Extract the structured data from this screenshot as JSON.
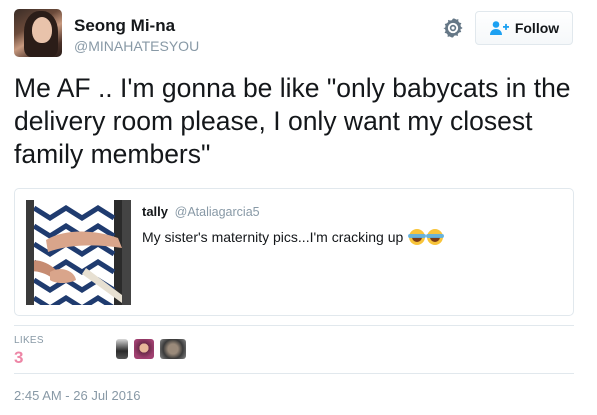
{
  "user": {
    "name": "Seong Mi-na",
    "handle": "@MINAHATESYOU"
  },
  "actions": {
    "follow_label": "Follow",
    "settings_icon": "gear-icon",
    "follow_icon": "add-user-icon"
  },
  "tweet": {
    "text": "Me AF .. I'm gonna be like \"only babycats in the delivery room please, I only want my closest family members\""
  },
  "quoted_tweet": {
    "name": "tally",
    "handle": "@Ataliagarcia5",
    "text": "My sister's maternity pics...I'm cracking up",
    "emojis": [
      "face-with-tears-of-joy",
      "face-with-tears-of-joy"
    ]
  },
  "stats": {
    "likes_label": "LIKES",
    "likes_count": "3"
  },
  "meta": {
    "timestamp": "2:45 AM - 26 Jul 2016"
  },
  "colors": {
    "text": "#14171a",
    "muted": "#8899a6",
    "border": "#e1e8ed",
    "like_count": "#e0245e",
    "follow_icon": "#1da1f2"
  }
}
